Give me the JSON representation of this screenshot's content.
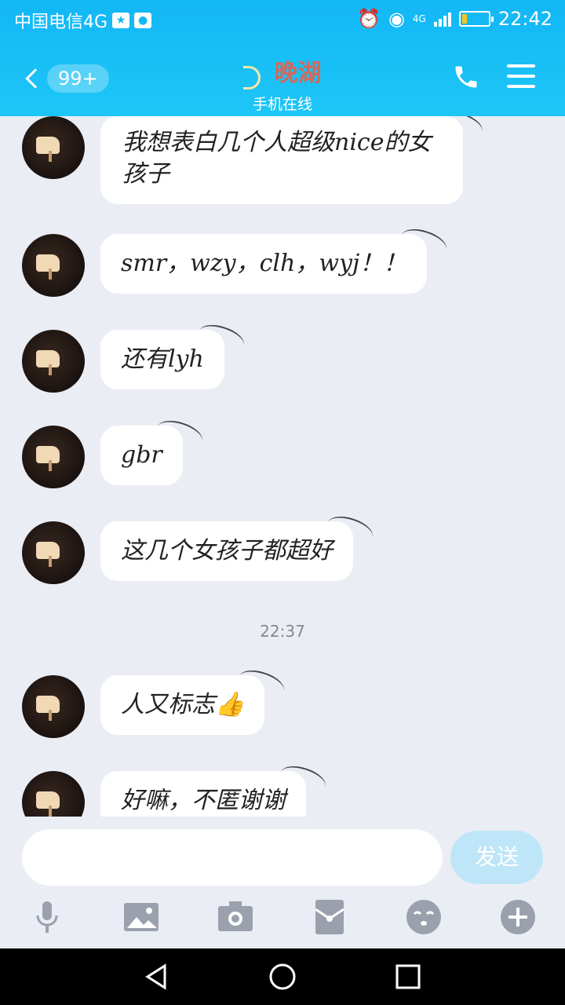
{
  "status_bar": {
    "carrier": "中国电信4G",
    "network": "4G",
    "time": "22:42",
    "battery_level": 0.2,
    "icons": [
      "star-badge-icon",
      "baidu-icon",
      "alarm-icon",
      "eye-icon",
      "signal-icon",
      "battery-icon"
    ]
  },
  "header": {
    "back_badge": "99+",
    "title": "晚湖",
    "subtitle": "手机在线",
    "accent_color": "#12b7f5",
    "title_color": "#d2695b"
  },
  "messages": [
    {
      "text": "我想表白几个人超级nice的女孩子"
    },
    {
      "text": "smr，wzy，clh，wyj！！"
    },
    {
      "text": "还有lyh"
    },
    {
      "text": "gbr"
    },
    {
      "text": "这几个女孩子都超好"
    },
    {
      "text": "人又标志👍"
    },
    {
      "text": "好嘛，不匿谢谢"
    }
  ],
  "timestamp": "22:37",
  "composer": {
    "placeholder": "",
    "send_label": "发送"
  },
  "toolbar_icons": [
    "microphone-icon",
    "image-icon",
    "camera-icon",
    "red-packet-icon",
    "emoji-icon",
    "plus-icon"
  ]
}
